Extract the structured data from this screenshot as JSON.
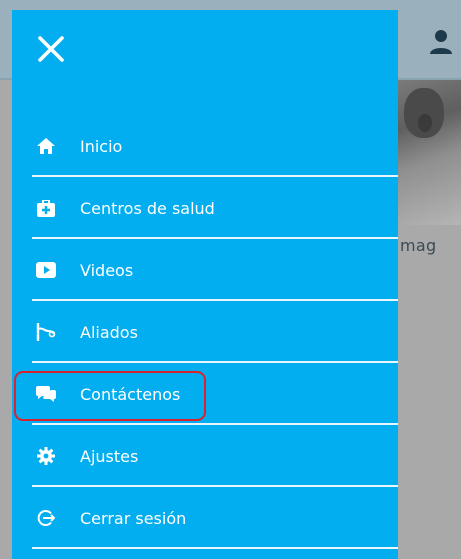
{
  "background": {
    "brand_text": "mag"
  },
  "drawer": {
    "close_icon": "close-icon",
    "items": [
      {
        "label": "Inicio",
        "icon": "home-icon"
      },
      {
        "label": "Centros de salud",
        "icon": "medical-kit-icon"
      },
      {
        "label": "Videos",
        "icon": "play-icon"
      },
      {
        "label": "Aliados",
        "icon": "handshake-icon"
      },
      {
        "label": "Contáctenos",
        "icon": "chat-icon",
        "highlighted": true
      },
      {
        "label": "Ajustes",
        "icon": "gear-icon"
      },
      {
        "label": "Cerrar sesión",
        "icon": "logout-icon"
      }
    ]
  },
  "colors": {
    "drawer_bg": "#02aef0",
    "text": "#ffffff",
    "highlight_border": "#d9232f",
    "overlay": "#a9a9a9"
  }
}
